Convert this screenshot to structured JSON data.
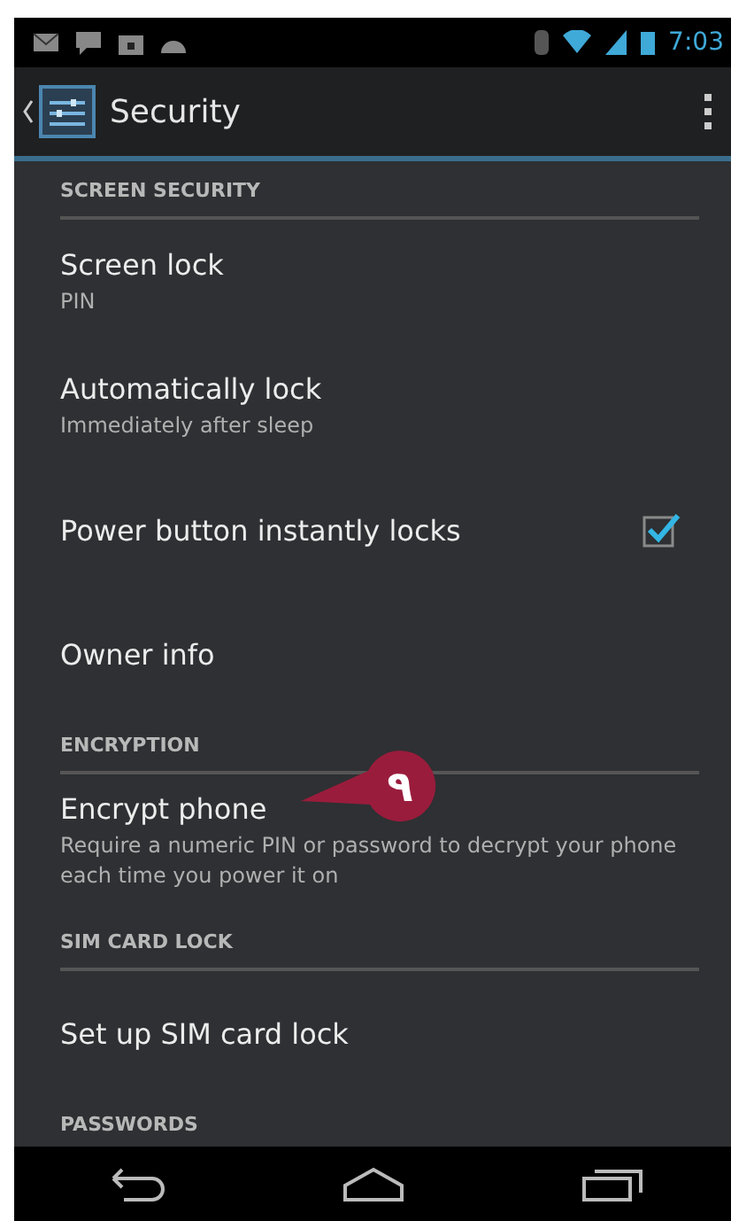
{
  "status_bar": {
    "time": "7:03"
  },
  "action_bar": {
    "title": "Security"
  },
  "sections": [
    {
      "header": "SCREEN SECURITY",
      "items": [
        {
          "kind": "text",
          "title": "Screen lock",
          "summary": "PIN"
        },
        {
          "kind": "text",
          "title": "Automatically lock",
          "summary": "Immediately after sleep"
        },
        {
          "kind": "checkbox",
          "title": "Power button instantly locks",
          "checked": true
        },
        {
          "kind": "text",
          "title": "Owner info"
        }
      ]
    },
    {
      "header": "ENCRYPTION",
      "items": [
        {
          "kind": "text",
          "title": "Encrypt phone",
          "summary": "Require a numeric PIN or password to decrypt your phone each time you power it on"
        }
      ]
    },
    {
      "header": "SIM CARD LOCK",
      "items": [
        {
          "kind": "text",
          "title": "Set up SIM card lock"
        }
      ]
    },
    {
      "header": "PASSWORDS"
    }
  ],
  "callout": {
    "label": "۹"
  }
}
